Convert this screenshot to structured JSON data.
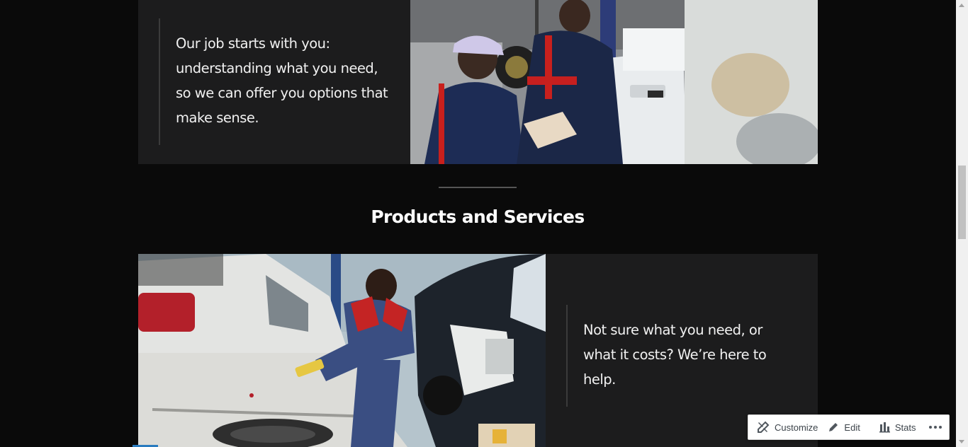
{
  "row1": {
    "quote": "Our job starts with you: understanding what you need, so we can offer you options that make sense.",
    "photo_icon": "mechanics-inspecting-car-photo"
  },
  "section": {
    "title": "Products and Services"
  },
  "row2": {
    "photo_icon": "mechanic-repairing-bumper-photo",
    "quote": "Not sure what you need, or what it costs? We’re here to help."
  },
  "admin_bar": {
    "customize_label": "Customize",
    "edit_label": "Edit",
    "stats_label": "Stats",
    "more_icon": "ellipsis-icon"
  },
  "colors": {
    "page_bg": "#0a0a0a",
    "panel_bg": "#1c1c1d",
    "text": "#f1f1f1",
    "admin_text": "#3c434a"
  }
}
